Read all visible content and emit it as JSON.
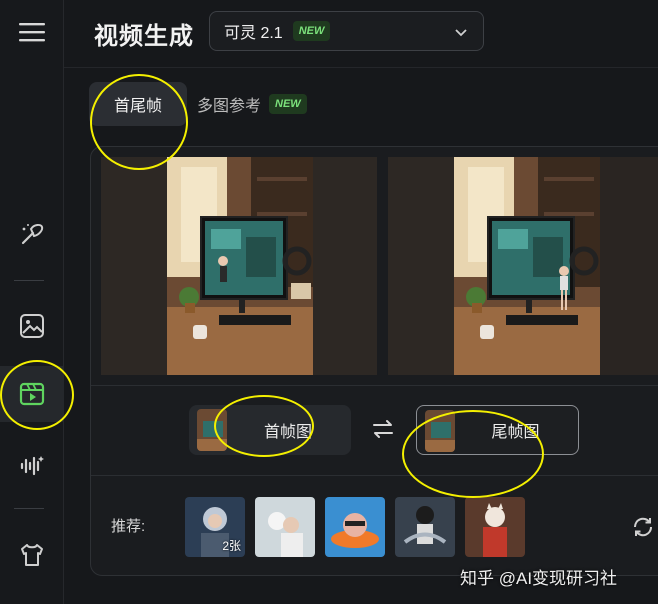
{
  "header": {
    "title": "视频生成",
    "model": "可灵 2.1",
    "model_badge": "NEW"
  },
  "tabs": [
    {
      "label": "首尾帧",
      "active": true
    },
    {
      "label": "多图参考",
      "badge": "NEW"
    }
  ],
  "sidebar": {
    "items": [
      {
        "icon": "menu-icon"
      },
      {
        "icon": "magic-brush-icon"
      },
      {
        "icon": "image-icon"
      },
      {
        "icon": "video-icon",
        "active": true
      },
      {
        "icon": "audio-wave-icon"
      },
      {
        "icon": "shirt-icon"
      }
    ],
    "active_color": "#5fd45f"
  },
  "frames": {
    "first_label": "首帧图",
    "last_label": "尾帧图"
  },
  "recommend": {
    "label": "推荐:",
    "first_count": "2张",
    "thumbnails": [
      "astronaut-girl",
      "white-cat-girl",
      "pig-on-float",
      "robot-panda",
      "cat-warrior"
    ]
  },
  "watermark": "知乎 @AI变现研习社",
  "colors": {
    "badge_green": "#7be07b",
    "annotation_yellow": "#f4f000"
  }
}
